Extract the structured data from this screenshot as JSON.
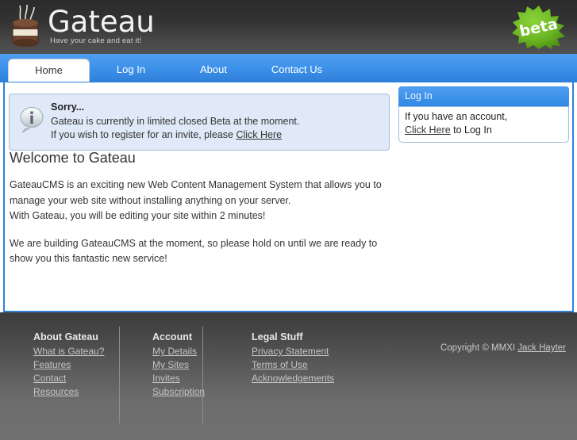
{
  "brand": {
    "name": "Gateau",
    "tagline": "Have your cake and eat it!",
    "logo_icon": "cake-icon",
    "beta_badge_label": "beta"
  },
  "nav": {
    "tabs": [
      {
        "label": "Home",
        "active": true
      },
      {
        "label": "Log In",
        "active": false
      },
      {
        "label": "About",
        "active": false
      },
      {
        "label": "Contact Us",
        "active": false
      }
    ]
  },
  "alert": {
    "icon": "info-speech-bubble-icon",
    "title": "Sorry...",
    "line1": "Gateau is currently in limited closed Beta at the moment.",
    "line2_prefix": "If you wish to register for an invite, please ",
    "line2_link": "Click Here"
  },
  "main": {
    "heading": "Welcome to Gateau",
    "paragraph1_line1": "GateauCMS is an exciting new Web Content Management System that allows you to",
    "paragraph1_line2": "manage your web site without installing anything on your server.",
    "paragraph1_line3": "With Gateau, you will be editing your site within 2 minutes!",
    "paragraph2_line1": "We are building GateauCMS at the moment, so please hold on until we are ready to",
    "paragraph2_line2": "show you this fantastic new service!"
  },
  "sidebar": {
    "login_box": {
      "header": "Log In",
      "line1": "If you have an account,",
      "line2_link": "Click Here",
      "line2_suffix": " to Log In"
    }
  },
  "footer": {
    "columns": [
      {
        "heading": "About Gateau",
        "links": [
          "What is Gateau?",
          "Features",
          "Contact",
          "Resources"
        ]
      },
      {
        "heading": "Account",
        "links": [
          "My Details",
          "My Sites",
          "Invites",
          "Subscription"
        ]
      },
      {
        "heading": "Legal Stuff",
        "links": [
          "Privacy Statement",
          "Terms of Use",
          "Acknowledgements"
        ]
      }
    ],
    "copyright_prefix": "Copyright © MMXI ",
    "copyright_link": "Jack Hayter"
  },
  "colors": {
    "accent_blue": "#3f93ea",
    "header_dark": "#333333",
    "footer_grey": "#5b5b5b",
    "beta_green": "#68b723",
    "alert_bg": "#dfe9f7"
  }
}
